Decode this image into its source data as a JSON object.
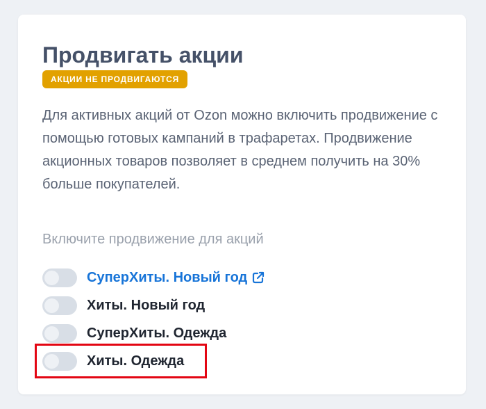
{
  "card": {
    "title": "Продвигать акции",
    "badge": "АКЦИИ НЕ ПРОДВИГАЮТСЯ",
    "description": "Для активных акций от Ozon можно включить продвижение с помощью готовых кампаний в трафаретах. Продвижение акционных товаров позволяет в среднем получить на 30% больше покупателей.",
    "hint": "Включите продвижение для акций"
  },
  "promotions": [
    {
      "label": "СуперХиты. Новый год",
      "enabled": false,
      "is_link": true,
      "icon": "external-link-icon"
    },
    {
      "label": "Хиты. Новый год",
      "enabled": false,
      "is_link": false
    },
    {
      "label": "СуперХиты. Одежда",
      "enabled": false,
      "is_link": false
    },
    {
      "label": "Хиты. Одежда",
      "enabled": false,
      "is_link": false,
      "highlighted": true
    }
  ],
  "colors": {
    "title": "#455168",
    "badge_bg": "#e2a100",
    "link": "#1774d8",
    "toggle_off": "#d8dee6",
    "highlight": "#e30613"
  }
}
